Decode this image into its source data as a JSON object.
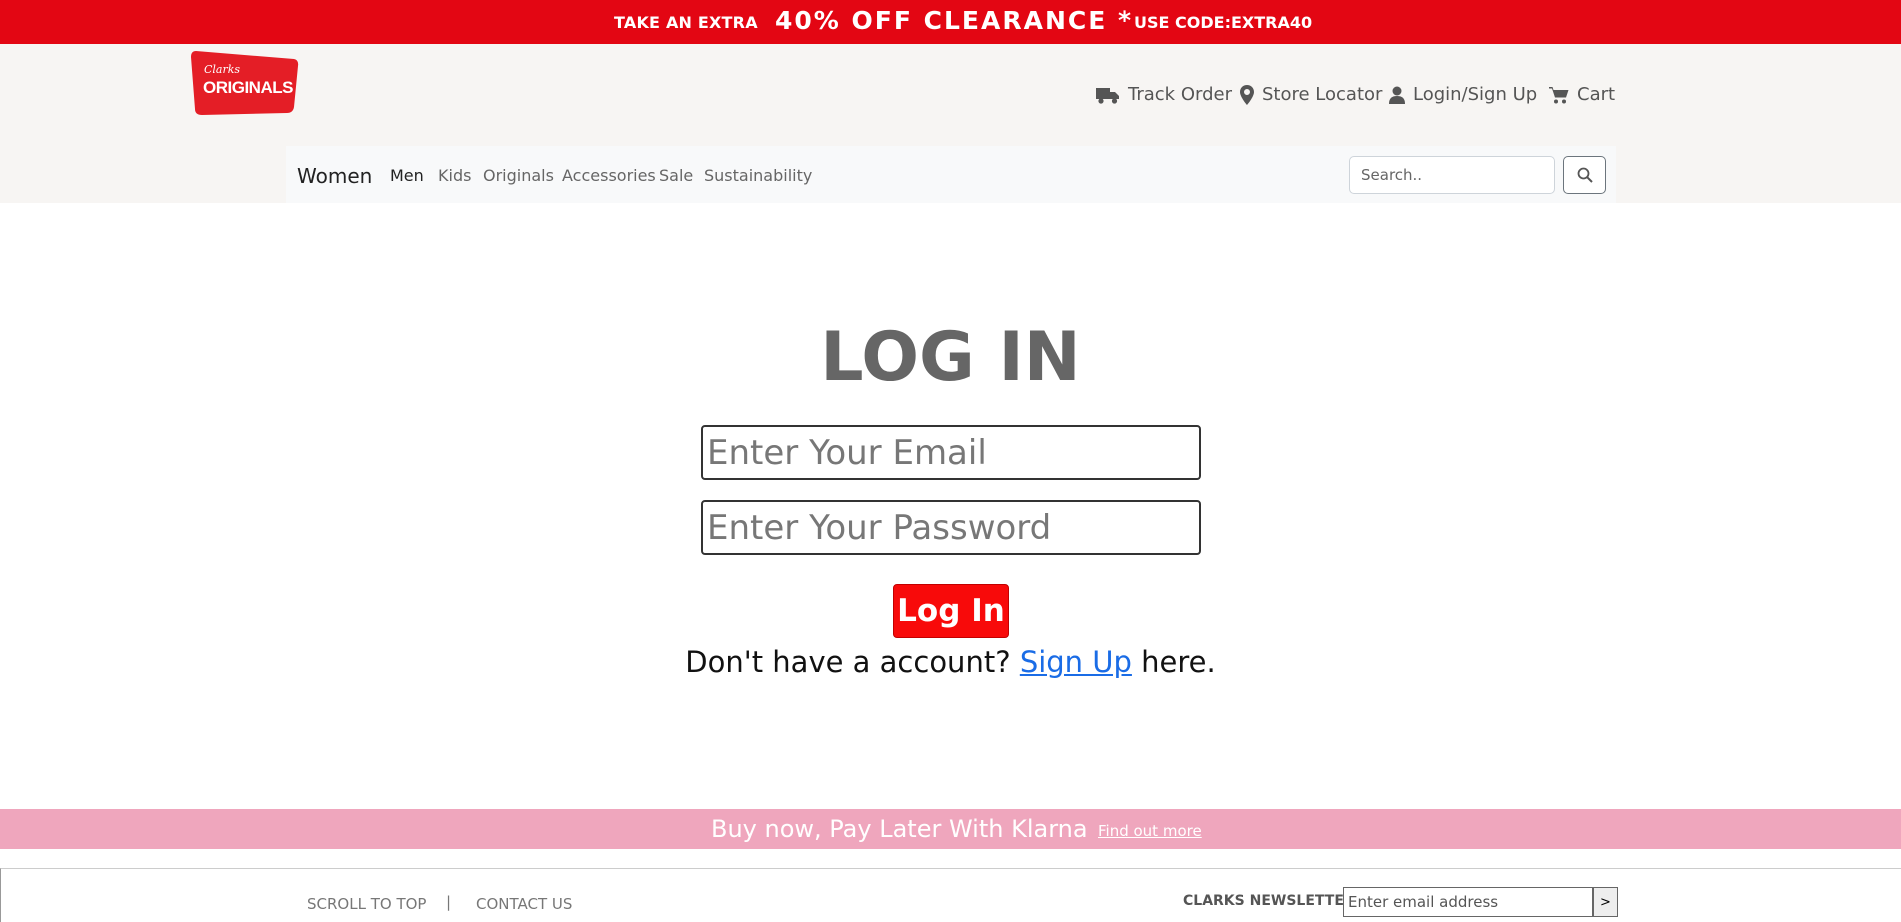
{
  "promo": {
    "left": "TAKE AN EXTRA",
    "center": "40% OFF CLEARANCE *",
    "right": "USE CODE:EXTRA40"
  },
  "header": {
    "logo_top": "Clarks",
    "logo_main": "ORIGINALS",
    "utility": {
      "track_order": "Track Order",
      "store_locator": "Store Locator",
      "login": "Login/Sign Up",
      "cart": "Cart"
    }
  },
  "nav": {
    "brand": "Women",
    "items": [
      "Men",
      "Kids",
      "Originals",
      "Accessories",
      "Sale",
      "Sustainability"
    ],
    "search_placeholder": "Search.."
  },
  "login": {
    "title": "LOG IN",
    "email_placeholder": "Enter Your Email",
    "password_placeholder": "Enter Your Password",
    "button": "Log In",
    "signup_prefix": "Don't have a account?",
    "signup_link": "Sign Up",
    "signup_suffix": "here."
  },
  "klarna": {
    "text": "Buy now, Pay Later With Klarna",
    "link": "Find out more"
  },
  "footer": {
    "scroll_top": "SCROLL TO TOP",
    "separator": "|",
    "contact": "CONTACT US",
    "newsletter_label": "CLARKS NEWSLETTER",
    "newsletter_placeholder": "Enter email address",
    "newsletter_button": ">"
  },
  "colors": {
    "promo_red": "#e30613",
    "button_red": "#f80a0a",
    "klarna_pink": "#efa6bd",
    "link_blue": "#1a6ce6"
  }
}
